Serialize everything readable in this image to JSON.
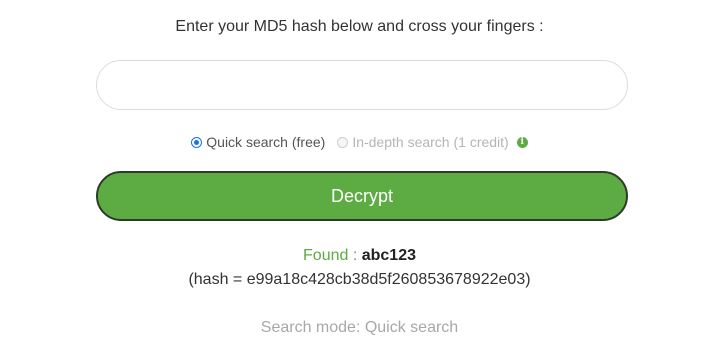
{
  "form": {
    "instruction": "Enter your MD5 hash below and cross your fingers :",
    "hash_input_value": "",
    "quick_label": "Quick search (free)",
    "depth_label": "In-depth search (1 credit)",
    "info_glyph": "i",
    "decrypt_label": "Decrypt"
  },
  "result": {
    "found_label": "Found : ",
    "found_value": "abc123",
    "hash_line": "(hash = e99a18c428cb38d5f260853678922e03)",
    "search_mode": "Search mode: Quick search"
  },
  "colors": {
    "accent_green": "#5dab43",
    "radio_blue": "#1a73e8",
    "button_border": "#2f3b2a"
  },
  "icons": {
    "info": "info-icon"
  }
}
